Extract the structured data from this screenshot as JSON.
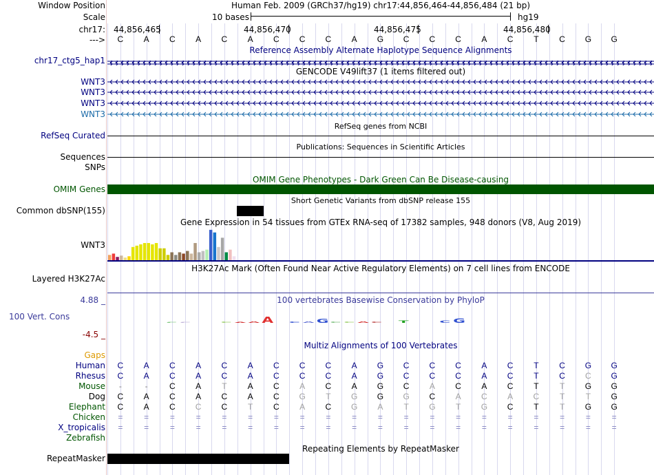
{
  "header": {
    "window_position_label": "Window Position",
    "scale_label": "Scale",
    "chrom_label": "chr17:",
    "arrow_label": "--->",
    "window_position_text": "Human Feb. 2009 (GRCh37/hg19)   chr17:44,856,464-44,856,484 (21 bp)",
    "scale_text": "10 bases",
    "assembly_text": "hg19",
    "positions": [
      "44,856,465",
      "44,856,470",
      "44,856,475",
      "44,856,480"
    ]
  },
  "reference_sequence": [
    "C",
    "A",
    "C",
    "A",
    "C",
    "A",
    "C",
    "C",
    "C",
    "A",
    "G",
    "C",
    "C",
    "C",
    "A",
    "C",
    "T",
    "C",
    "G",
    "G"
  ],
  "tracks": {
    "alt_haplotype": {
      "title": "Reference Assembly Alternate Haplotype Sequence Alignments",
      "label": "chr17_ctg5_hap1"
    },
    "gencode": {
      "title": "GENCODE V49lift37 (1 items filtered out)",
      "labels": [
        "WNT3",
        "WNT3",
        "WNT3",
        "WNT3"
      ]
    },
    "refseq": {
      "title": "RefSeq genes from NCBI",
      "label": "RefSeq Curated"
    },
    "publications": {
      "title": "Publications: Sequences in Scientific Articles",
      "label": "Sequences"
    },
    "snps": {
      "label": "SNPs"
    },
    "omim": {
      "title": "OMIM Gene Phenotypes - Dark Green Can Be Disease-causing",
      "label": "OMIM Genes"
    },
    "dbsnp": {
      "title": "Short Genetic Variants from dbSNP release 155",
      "label": "Common dbSNP(155)"
    },
    "gtex": {
      "title": "Gene Expression in 54 tissues from GTEx RNA-seq of 17382 samples, 948 donors (V8, Aug 2019)",
      "label": "WNT3"
    },
    "h3k27ac": {
      "title": "H3K27Ac Mark (Often Found Near Active Regulatory Elements) on 7 cell lines from ENCODE",
      "label": "Layered H3K27Ac"
    },
    "conservation": {
      "title": "100 vertebrates Basewise Conservation by PhyloP",
      "label": "100 Vert. Cons",
      "max_label": "4.88 _",
      "min_label": "-4.5 _"
    },
    "multiz": {
      "title": "Multiz Alignments of 100 Vertebrates"
    },
    "repeatmasker": {
      "title": "Repeating Elements by RepeatMasker",
      "label": "RepeatMasker"
    }
  },
  "alignment": {
    "gaps_label": "Gaps",
    "species": [
      {
        "name": "Human",
        "bases": [
          "C",
          "A",
          "C",
          "A",
          "C",
          "A",
          "C",
          "C",
          "C",
          "A",
          "G",
          "C",
          "C",
          "C",
          "A",
          "C",
          "T",
          "C",
          "G",
          "G"
        ]
      },
      {
        "name": "Rhesus",
        "bases": [
          "C",
          "A",
          "C",
          "A",
          "C",
          "A",
          "C",
          "C",
          "C",
          "A",
          "G",
          "C",
          "C",
          "C",
          "A",
          "C",
          "T",
          "C",
          "C",
          "G"
        ]
      },
      {
        "name": "Mouse",
        "bases": [
          "-",
          "-",
          "C",
          "A",
          "T",
          "A",
          "C",
          "A",
          "C",
          "A",
          "G",
          "C",
          "A",
          "C",
          "A",
          "C",
          "T",
          "T",
          "G",
          "G"
        ]
      },
      {
        "name": "Dog",
        "bases": [
          "C",
          "A",
          "C",
          "A",
          "C",
          "A",
          "C",
          "G",
          "T",
          "G",
          "G",
          "G",
          "C",
          "A",
          "C",
          "A",
          "C",
          "T",
          "T",
          "G"
        ]
      },
      {
        "name": "Elephant",
        "bases": [
          "C",
          "A",
          "C",
          "C",
          "C",
          "T",
          "C",
          "A",
          "C",
          "G",
          "A",
          "T",
          "G",
          "T",
          "G",
          "C",
          "T",
          "T",
          "G",
          "G"
        ]
      },
      {
        "name": "Chicken",
        "bases": [
          "=",
          "=",
          "=",
          "=",
          "=",
          "=",
          "=",
          "=",
          "=",
          "=",
          "=",
          "=",
          "=",
          "=",
          "=",
          "=",
          "=",
          "=",
          "=",
          "="
        ]
      },
      {
        "name": "X_tropicalis",
        "bases": [
          "=",
          "=",
          "=",
          "=",
          "=",
          "=",
          "=",
          "=",
          "=",
          "=",
          "=",
          "=",
          "=",
          "=",
          "=",
          "=",
          "=",
          "=",
          "=",
          "="
        ]
      },
      {
        "name": "Zebrafish",
        "bases": []
      }
    ]
  },
  "gtex_values": [
    8,
    10,
    5,
    7,
    4,
    6,
    20,
    22,
    24,
    26,
    26,
    24,
    26,
    18,
    18,
    8,
    12,
    8,
    12,
    10,
    14,
    10,
    26,
    12,
    14,
    16,
    46,
    42,
    20,
    34,
    12,
    16,
    6
  ],
  "gtex_colors": [
    "#f4a460",
    "#ee3b3b",
    "#8b1c62",
    "#cdb79e",
    "#eedd82",
    "#ffd700",
    "#e5e500",
    "#e5e500",
    "#e5e500",
    "#e5e500",
    "#e5e500",
    "#e5e500",
    "#e5e500",
    "#cdcd00",
    "#cdcd00",
    "#cdcd00",
    "#8b7355",
    "#8b8b83",
    "#8b7355",
    "#8b4726",
    "#8b7355",
    "#cdb79e",
    "#b09a80",
    "#aaaaaa",
    "#c0c0c0",
    "#b4eeb4",
    "#3a5fcd",
    "#1874cd",
    "#cdc9c9",
    "#a6a6a6",
    "#008b45",
    "#f0c0c0",
    "#f0e0f0"
  ],
  "colors": {
    "label_blue": "#000080",
    "omim_green": "#005500",
    "gaps_orange": "#dd9900",
    "cons_blue": "#3a3a9a",
    "cons_red": "#880000"
  }
}
